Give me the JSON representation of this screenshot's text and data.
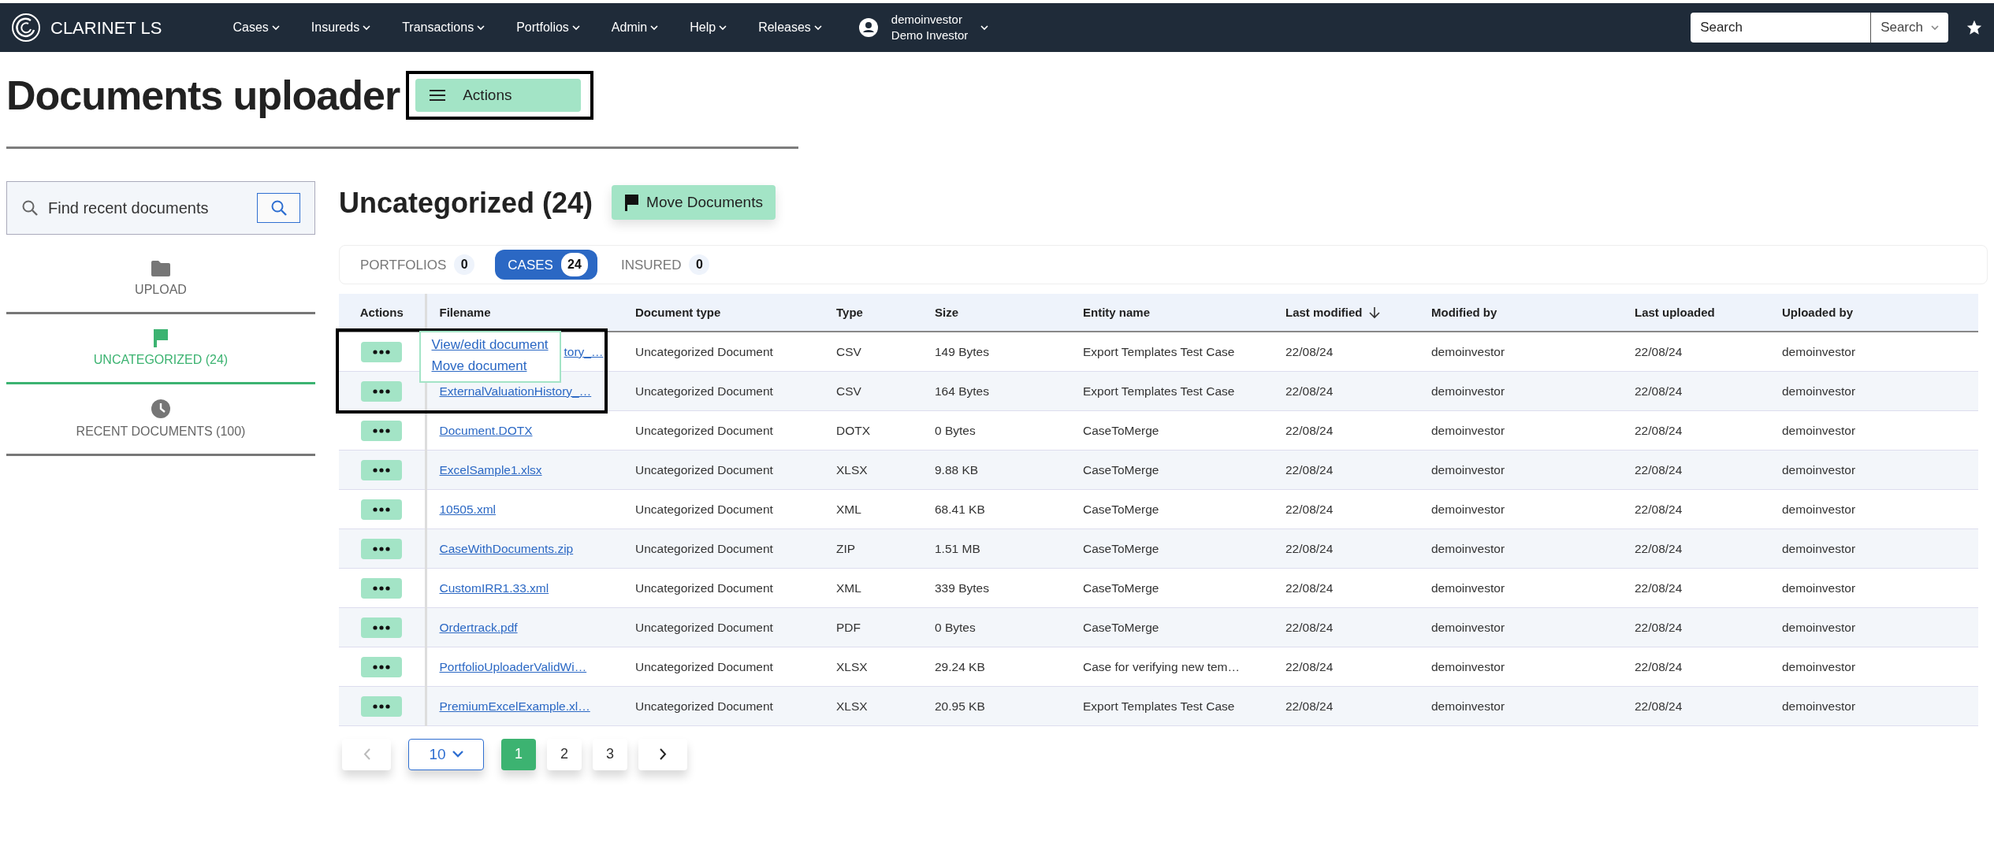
{
  "navbar": {
    "brand": "CLARINET LS",
    "menus": [
      {
        "label": "Cases"
      },
      {
        "label": "Insureds"
      },
      {
        "label": "Transactions"
      },
      {
        "label": "Portfolios"
      },
      {
        "label": "Admin"
      },
      {
        "label": "Help"
      },
      {
        "label": "Releases"
      }
    ],
    "user": {
      "username": "demoinvestor",
      "display_name": "Demo Investor"
    },
    "search": {
      "placeholder": "Search",
      "button": "Search"
    }
  },
  "page": {
    "title": "Documents uploader",
    "actions_button": {
      "label": "Actions",
      "highlighted": true
    }
  },
  "sidebar": {
    "search": {
      "placeholder": "Find recent documents"
    },
    "items": [
      {
        "kind": "folder",
        "label": "UPLOAD",
        "selected": false
      },
      {
        "kind": "flag",
        "label": "UNCATEGORIZED (24)",
        "selected": true
      },
      {
        "kind": "clock",
        "label": "RECENT DOCUMENTS (100)",
        "selected": false
      }
    ]
  },
  "section": {
    "title": "Uncategorized (24)",
    "move_button": "Move Documents",
    "tabs": [
      {
        "label": "PORTFOLIOS",
        "count": "0",
        "selected": false
      },
      {
        "label": "CASES",
        "count": "24",
        "selected": true
      },
      {
        "label": "INSURED",
        "count": "0",
        "selected": false
      }
    ]
  },
  "table": {
    "columns": [
      {
        "label": "Actions"
      },
      {
        "label": "Filename"
      },
      {
        "label": "Document type"
      },
      {
        "label": "Type"
      },
      {
        "label": "Size"
      },
      {
        "label": "Entity name"
      },
      {
        "label": "Last modified",
        "sorted": true
      },
      {
        "label": "Modified by"
      },
      {
        "label": "Last uploaded"
      },
      {
        "label": "Uploaded by"
      }
    ],
    "rows": [
      {
        "filename": "tory_…",
        "document_type": "Uncategorized Document",
        "type": "CSV",
        "size": "149 Bytes",
        "entity_name": "Export Templates Test Case",
        "last_modified": "22/08/24",
        "modified_by": "demoinvestor",
        "last_uploaded": "22/08/24",
        "uploaded_by": "demoinvestor",
        "highlighted": true,
        "menu": [
          "View/edit document",
          "Move document"
        ]
      },
      {
        "filename": "ExternalValuationHistory_…",
        "document_type": "Uncategorized Document",
        "type": "CSV",
        "size": "164 Bytes",
        "entity_name": "Export Templates Test Case",
        "last_modified": "22/08/24",
        "modified_by": "demoinvestor",
        "last_uploaded": "22/08/24",
        "uploaded_by": "demoinvestor"
      },
      {
        "filename": "Document.DOTX",
        "document_type": "Uncategorized Document",
        "type": "DOTX",
        "size": "0 Bytes",
        "entity_name": "CaseToMerge",
        "last_modified": "22/08/24",
        "modified_by": "demoinvestor",
        "last_uploaded": "22/08/24",
        "uploaded_by": "demoinvestor"
      },
      {
        "filename": "ExcelSample1.xlsx",
        "document_type": "Uncategorized Document",
        "type": "XLSX",
        "size": "9.88 KB",
        "entity_name": "CaseToMerge",
        "last_modified": "22/08/24",
        "modified_by": "demoinvestor",
        "last_uploaded": "22/08/24",
        "uploaded_by": "demoinvestor"
      },
      {
        "filename": "10505.xml",
        "document_type": "Uncategorized Document",
        "type": "XML",
        "size": "68.41 KB",
        "entity_name": "CaseToMerge",
        "last_modified": "22/08/24",
        "modified_by": "demoinvestor",
        "last_uploaded": "22/08/24",
        "uploaded_by": "demoinvestor"
      },
      {
        "filename": "CaseWithDocuments.zip",
        "document_type": "Uncategorized Document",
        "type": "ZIP",
        "size": "1.51 MB",
        "entity_name": "CaseToMerge",
        "last_modified": "22/08/24",
        "modified_by": "demoinvestor",
        "last_uploaded": "22/08/24",
        "uploaded_by": "demoinvestor"
      },
      {
        "filename": "CustomIRR1.33.xml",
        "document_type": "Uncategorized Document",
        "type": "XML",
        "size": "339 Bytes",
        "entity_name": "CaseToMerge",
        "last_modified": "22/08/24",
        "modified_by": "demoinvestor",
        "last_uploaded": "22/08/24",
        "uploaded_by": "demoinvestor"
      },
      {
        "filename": "Ordertrack.pdf",
        "document_type": "Uncategorized Document",
        "type": "PDF",
        "size": "0 Bytes",
        "entity_name": "CaseToMerge",
        "last_modified": "22/08/24",
        "modified_by": "demoinvestor",
        "last_uploaded": "22/08/24",
        "uploaded_by": "demoinvestor"
      },
      {
        "filename": "PortfolioUploaderValidWi…",
        "document_type": "Uncategorized Document",
        "type": "XLSX",
        "size": "29.24 KB",
        "entity_name": "Case for verifying new tem…",
        "last_modified": "22/08/24",
        "modified_by": "demoinvestor",
        "last_uploaded": "22/08/24",
        "uploaded_by": "demoinvestor"
      },
      {
        "filename": "PremiumExcelExample.xl…",
        "document_type": "Uncategorized Document",
        "type": "XLSX",
        "size": "20.95 KB",
        "entity_name": "Export Templates Test Case",
        "last_modified": "22/08/24",
        "modified_by": "demoinvestor",
        "last_uploaded": "22/08/24",
        "uploaded_by": "demoinvestor"
      }
    ]
  },
  "pagination": {
    "prev_disabled": true,
    "page_size": "10",
    "pages": [
      {
        "label": "1",
        "selected": true
      },
      {
        "label": "2",
        "selected": false
      },
      {
        "label": "3",
        "selected": false
      }
    ]
  }
}
